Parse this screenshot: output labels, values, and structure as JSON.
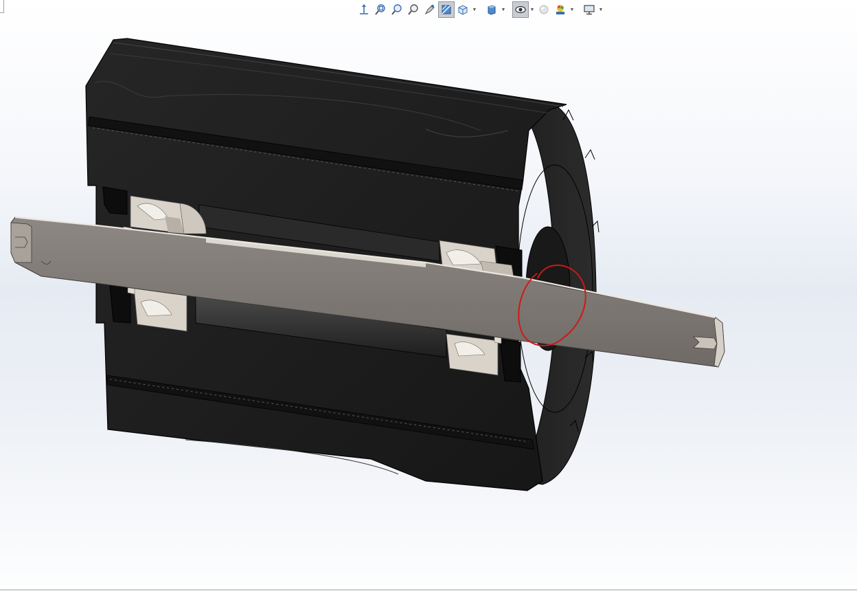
{
  "window": {
    "title": ""
  },
  "toolbar": {
    "buttons": [
      {
        "icon": "view-triad-icon",
        "active": false,
        "dropdown": false
      },
      {
        "icon": "zoom-to-fit-icon",
        "active": false,
        "dropdown": false
      },
      {
        "icon": "zoom-to-area-icon",
        "active": false,
        "dropdown": false
      },
      {
        "icon": "previous-view-icon",
        "active": false,
        "dropdown": false
      },
      {
        "icon": "dynamic-annotation-icon",
        "active": false,
        "dropdown": false
      },
      {
        "icon": "section-view-icon",
        "active": true,
        "dropdown": false
      },
      {
        "icon": "view-orientation-icon",
        "active": false,
        "dropdown": true
      },
      {
        "icon": "display-style-icon",
        "active": false,
        "dropdown": true
      },
      {
        "icon": "hide-show-items-icon",
        "active": true,
        "dropdown": true
      },
      {
        "icon": "edit-appearance-icon",
        "active": false,
        "dropdown": false
      },
      {
        "icon": "apply-scene-icon",
        "active": false,
        "dropdown": true
      },
      {
        "icon": "view-settings-icon",
        "active": false,
        "dropdown": true
      }
    ]
  },
  "model": {
    "type": "section view of roller assembly",
    "colors": {
      "roller_body": "#1c1c1c",
      "roller_edge": "#2d2d2d",
      "shaft": "#7d7873",
      "shaft_highlight": "#ebe6de",
      "bearing": "#d9d3ca",
      "markup_circle": "#d01818"
    }
  }
}
